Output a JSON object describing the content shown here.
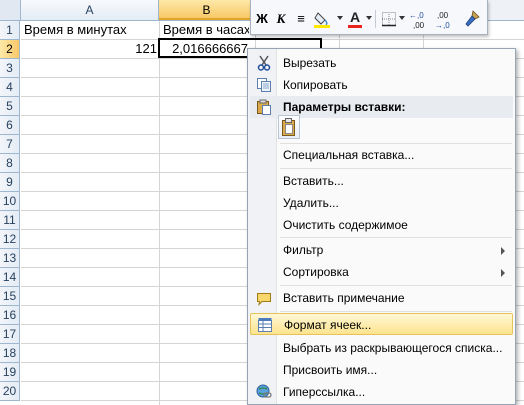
{
  "columns": [
    "A",
    "B"
  ],
  "rows": [
    "1",
    "2",
    "3",
    "4",
    "5",
    "6",
    "7",
    "8",
    "9",
    "10",
    "11",
    "12",
    "13",
    "14",
    "15",
    "16",
    "17",
    "18",
    "19",
    "20"
  ],
  "cells": {
    "a1": "Время в минутах",
    "b1": "Время в часах",
    "a2": "121",
    "b2": "2,016666667"
  },
  "toolbar": {
    "bold": "Ж",
    "italic": "К",
    "align": "≡",
    "font_color_letter": "A",
    "dec_increase": "←,0\n,00",
    "dec_decrease": ",00\n→,0"
  },
  "context_menu": {
    "items": [
      {
        "label": "Вырезать",
        "icon": "scissors-icon"
      },
      {
        "label": "Копировать",
        "icon": "copy-icon"
      },
      {
        "label": "Параметры вставки:",
        "icon": "paste-icon",
        "header": true
      },
      {
        "label": "Специальная вставка..."
      },
      {
        "label": "Вставить..."
      },
      {
        "label": "Удалить..."
      },
      {
        "label": "Очистить содержимое"
      },
      {
        "label": "Фильтр",
        "submenu": true
      },
      {
        "label": "Сортировка",
        "submenu": true
      },
      {
        "label": "Вставить примечание",
        "icon": "comment-icon"
      },
      {
        "label": "Формат ячеек...",
        "icon": "format-cells-icon",
        "highlighted": true
      },
      {
        "label": "Выбрать из раскрывающегося списка..."
      },
      {
        "label": "Присвоить имя..."
      },
      {
        "label": "Гиперссылка...",
        "icon": "hyperlink-icon"
      }
    ]
  },
  "colors": {
    "highlight": "#fde48e",
    "header_text": "#27415f",
    "selected_header": "#f8c868"
  }
}
